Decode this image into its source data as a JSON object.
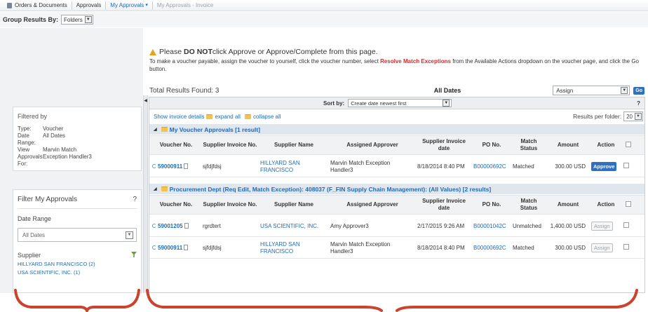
{
  "breadcrumb": {
    "items": [
      {
        "label": "Orders & Documents"
      },
      {
        "label": "Approvals"
      },
      {
        "label": "My Approvals"
      },
      {
        "label": "My Approvals - Invoice"
      }
    ]
  },
  "group": {
    "label": "Group Results By:",
    "value": "Folders"
  },
  "filtered_by": {
    "title": "Filtered by",
    "rows": [
      {
        "k": "Type:",
        "v": "Voucher"
      },
      {
        "k": "Date Range:",
        "v": "All Dates"
      },
      {
        "k": "View Approvals For:",
        "v": "Marvin Match Exception Handler3"
      }
    ]
  },
  "filter_panel": {
    "title": "Filter My Approvals",
    "help": "?",
    "date_label": "Date Range",
    "date_value": "All Dates",
    "supplier_label": "Supplier",
    "suppliers": [
      "HILLYARD SAN FRANCISCO (2)",
      "USA SCIENTIFIC, INC. (1)"
    ]
  },
  "warning": {
    "pre": "Please ",
    "bold": "DO NOT",
    "post": " click Approve or Approve/Complete from this page.",
    "line2_pre": "To make a voucher payable, assign the voucher to yourself, click the voucher number, select ",
    "line2_red": "Resolve Match Exceptions",
    "line2_post": " from the Available Actions dropdown on the voucher page, and click the Go button."
  },
  "summary": {
    "total": "Total Results Found: 3",
    "date_filter": "All Dates",
    "action_value": "Assign",
    "go": "Go"
  },
  "sort": {
    "label": "Sort by:",
    "value": "Create date newest first",
    "help": "?"
  },
  "details": {
    "show": "Show invoice details",
    "expand": "expand all",
    "collapse": "collapse all",
    "rpf_label": "Results per folder:",
    "rpf_value": "20"
  },
  "columns": [
    "Voucher No.",
    "Supplier Invoice No.",
    "Supplier Name",
    "Assigned Approver",
    "Supplier Invoice date",
    "PO No.",
    "Match Status",
    "Amount",
    "Action"
  ],
  "folders": [
    {
      "title": "My Voucher Approvals [1 result]",
      "rows": [
        {
          "voucher": "59000911",
          "inv": "sjfdjfdsj",
          "supplier": "HILLYARD SAN FRANCISCO",
          "approver": "Marvin Match Exception Handler3",
          "date": "8/18/2014 8:40 PM",
          "po": "B00000692C",
          "status": "Matched",
          "amount": "300.00 USD",
          "action": "Approve"
        }
      ]
    },
    {
      "title": "Procurement Dept (Req Edit, Match Exception): 408037 (F_FIN Supply Chain Management): (All Values) [2 results]",
      "rows": [
        {
          "voucher": "59001205",
          "inv": "rgrdtert",
          "supplier": "USA SCIENTIFIC, INC.",
          "approver": "Amy Approver3",
          "date": "2/17/2015 9:26 AM",
          "po": "B00001042C",
          "status": "Unmatched",
          "amount": "1,400.00 USD",
          "action": "Assign"
        },
        {
          "voucher": "59000911",
          "inv": "sjfdjfdsj",
          "supplier": "HILLYARD SAN FRANCISCO",
          "approver": "Marvin Match Exception Handler3",
          "date": "8/18/2014 8:40 PM",
          "po": "B00000692C",
          "status": "Matched",
          "amount": "300.00 USD",
          "action": "Assign"
        }
      ]
    }
  ],
  "colors": {
    "accent": "#1f6bb5",
    "button": "#2e70c4",
    "warning_red": "#d62a2a",
    "bracket": "#c8442e"
  }
}
